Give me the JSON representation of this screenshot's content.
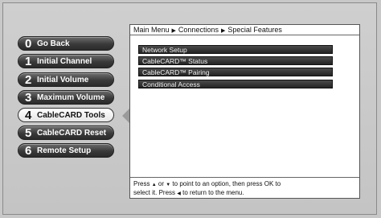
{
  "menu": {
    "items": [
      {
        "num": "0",
        "label": "Go Back"
      },
      {
        "num": "1",
        "label": "Initial Channel"
      },
      {
        "num": "2",
        "label": "Initial Volume"
      },
      {
        "num": "3",
        "label": "Maximum Volume"
      },
      {
        "num": "4",
        "label": "CableCARD Tools"
      },
      {
        "num": "5",
        "label": "CableCARD Reset"
      },
      {
        "num": "6",
        "label": "Remote Setup"
      }
    ],
    "selected_index": 4
  },
  "breadcrumb": {
    "items": [
      "Main Menu",
      "Connections",
      "Special Features"
    ],
    "separator_icon": "triangle-right-icon"
  },
  "options": [
    "Network Setup",
    "CableCARD™ Status",
    "CableCARD™ Pairing",
    "Conditional Access"
  ],
  "help": {
    "line1_a": "Press",
    "line1_b": "or",
    "line1_c": "to point to an option, then press OK to",
    "line2_a": "select it. Press",
    "line2_b": "to return to the menu.",
    "up_icon": "up-arrow-icon",
    "down_icon": "down-arrow-icon",
    "left_icon": "left-arrow-icon"
  }
}
